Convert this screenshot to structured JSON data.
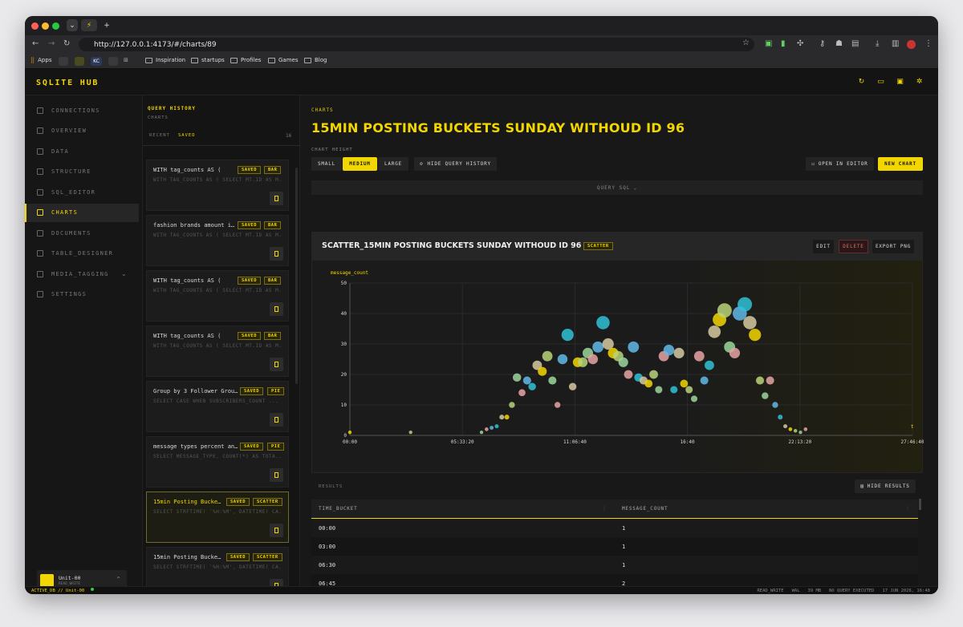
{
  "browser": {
    "url": "http://127.0.0.1:4173/#/charts/89",
    "bookmarks": [
      "Apps",
      "KC",
      "Inspiration",
      "startups",
      "Profiles",
      "Games",
      "Blog"
    ]
  },
  "app": {
    "brand": "SQLITE HUB",
    "nav": [
      {
        "label": "CONNECTIONS",
        "icon": "database-icon"
      },
      {
        "label": "OVERVIEW",
        "icon": "grid-icon"
      },
      {
        "label": "DATA",
        "icon": "table-icon"
      },
      {
        "label": "STRUCTURE",
        "icon": "structure-icon"
      },
      {
        "label": "SQL_EDITOR",
        "icon": "terminal-icon"
      },
      {
        "label": "CHARTS",
        "icon": "bar-chart-icon",
        "active": true
      },
      {
        "label": "DOCUMENTS",
        "icon": "document-icon"
      },
      {
        "label": "TABLE_DESIGNER",
        "icon": "layout-icon"
      },
      {
        "label": "MEDIA_TAGGING",
        "icon": "tag-icon"
      },
      {
        "label": "SETTINGS",
        "icon": "gear-icon"
      }
    ],
    "user": {
      "name": "Unit-00",
      "role": "READ_WRITE"
    }
  },
  "history": {
    "title": "QUERY HISTORY",
    "subtitle": "CHARTS",
    "tabs": [
      "RECENT",
      "SAVED"
    ],
    "count": "16",
    "items": [
      {
        "title": "WITH tag_counts AS (",
        "sql": "WITH TAG_COUNTS AS ( SELECT MT.ID AS M...",
        "status": "SAVED",
        "type": "BAR"
      },
      {
        "title": "fashion brands amount i…",
        "sql": "WITH TAG_COUNTS AS ( SELECT MT.ID AS M...",
        "status": "SAVED",
        "type": "BAR"
      },
      {
        "title": "WITH tag_counts AS (",
        "sql": "WITH TAG_COUNTS AS ( SELECT MT.ID AS M...",
        "status": "SAVED",
        "type": "BAR"
      },
      {
        "title": "WITH tag_counts AS (",
        "sql": "WITH TAG_COUNTS AS ( SELECT MT.ID AS M...",
        "status": "SAVED",
        "type": "BAR"
      },
      {
        "title": "Group by 3 Follower Grou…",
        "sql": "SELECT CASE WHEN SUBSCRIBERS_COUNT ...",
        "status": "SAVED",
        "type": "PIE"
      },
      {
        "title": "message types percent an…",
        "sql": "SELECT MESSAGE_TYPE, COUNT(*) AS TOTA...",
        "status": "SAVED",
        "type": "PIE"
      },
      {
        "title": "15min Posting Bucke…",
        "sql": "SELECT STRFTIME( '%H:%M', DATETIME( CA...",
        "status": "SAVED",
        "type": "SCATTER"
      },
      {
        "title": "15min Posting Bucke…",
        "sql": "SELECT STRFTIME( '%H:%M', DATETIME( CA...",
        "status": "SAVED",
        "type": "SCATTER"
      }
    ]
  },
  "main": {
    "section": "CHARTS",
    "title": "15MIN POSTING BUCKETS SUNDAY WITHOUD ID 96",
    "height_label": "CHART HEIGHT",
    "sizes": [
      "SMALL",
      "MEDIUM",
      "LARGE"
    ],
    "hide_history": "HIDE QUERY HISTORY",
    "open_editor": "OPEN IN EDITOR",
    "new_chart": "NEW CHART",
    "query_sql": "QUERY SQL",
    "chart_title": "SCATTER_15MIN POSTING BUCKETS SUNDAY WITHOUD ID 96",
    "chart_type": "SCATTER",
    "edit": "EDIT",
    "delete": "DELETE",
    "export": "EXPORT PNG",
    "results_label": "RESULTS",
    "hide_results": "HIDE RESULTS",
    "columns": [
      "TIME_BUCKET",
      "MESSAGE_COUNT"
    ],
    "rows": [
      [
        "00:00",
        "1"
      ],
      [
        "03:00",
        "1"
      ],
      [
        "06:30",
        "1"
      ],
      [
        "06:45",
        "2"
      ]
    ]
  },
  "status": {
    "left": "ACTIVE_DB // Unit-00",
    "right": [
      "READ_WRITE",
      "WAL",
      "39 MB",
      "NO QUERY EXECUTED",
      "17 JUN 2026, 16:48"
    ]
  },
  "colors": {
    "accent": "#f2d600",
    "delete": "#e26b6b"
  },
  "chart_data": {
    "type": "scatter",
    "ylabel": "message_count",
    "xlabel": "t",
    "ylim": [
      0,
      50
    ],
    "x_ticks": [
      "00:00",
      "05:33:20",
      "11:06:40",
      "16:40",
      "22:13:20",
      "27:46:40"
    ],
    "y_ticks": [
      0,
      10,
      20,
      30,
      40,
      50
    ],
    "points": [
      [
        0.0,
        1
      ],
      [
        3.0,
        1
      ],
      [
        6.5,
        1
      ],
      [
        6.75,
        2
      ],
      [
        7.0,
        2.5
      ],
      [
        7.25,
        3
      ],
      [
        7.5,
        6
      ],
      [
        7.75,
        6
      ],
      [
        8.0,
        10
      ],
      [
        8.25,
        19
      ],
      [
        8.5,
        14
      ],
      [
        8.75,
        18
      ],
      [
        9.0,
        16
      ],
      [
        9.25,
        23
      ],
      [
        9.5,
        21
      ],
      [
        9.75,
        26
      ],
      [
        10.0,
        18
      ],
      [
        10.25,
        10
      ],
      [
        10.5,
        25
      ],
      [
        10.75,
        33
      ],
      [
        11.0,
        16
      ],
      [
        11.25,
        24
      ],
      [
        11.5,
        24
      ],
      [
        11.75,
        27
      ],
      [
        12.0,
        25
      ],
      [
        12.25,
        29
      ],
      [
        12.5,
        37
      ],
      [
        12.75,
        30
      ],
      [
        13.0,
        27
      ],
      [
        13.25,
        26
      ],
      [
        13.5,
        24
      ],
      [
        13.75,
        20
      ],
      [
        14.0,
        29
      ],
      [
        14.25,
        19
      ],
      [
        14.5,
        18
      ],
      [
        14.75,
        17
      ],
      [
        15.0,
        20
      ],
      [
        15.25,
        15
      ],
      [
        15.5,
        26
      ],
      [
        15.75,
        28
      ],
      [
        16.0,
        15
      ],
      [
        16.25,
        27
      ],
      [
        16.5,
        17
      ],
      [
        16.75,
        15
      ],
      [
        17.0,
        12
      ],
      [
        17.25,
        26
      ],
      [
        17.5,
        18
      ],
      [
        17.75,
        23
      ],
      [
        18.0,
        34
      ],
      [
        18.25,
        38
      ],
      [
        18.5,
        41
      ],
      [
        18.75,
        29
      ],
      [
        19.0,
        27
      ],
      [
        19.25,
        40
      ],
      [
        19.5,
        43
      ],
      [
        19.75,
        37
      ],
      [
        20.0,
        33
      ],
      [
        20.25,
        18
      ],
      [
        20.5,
        13
      ],
      [
        20.75,
        18
      ],
      [
        21.0,
        10
      ],
      [
        21.25,
        6
      ],
      [
        21.5,
        3
      ],
      [
        21.75,
        2
      ],
      [
        22.0,
        1.5
      ],
      [
        22.25,
        1
      ],
      [
        22.5,
        2
      ]
    ]
  }
}
